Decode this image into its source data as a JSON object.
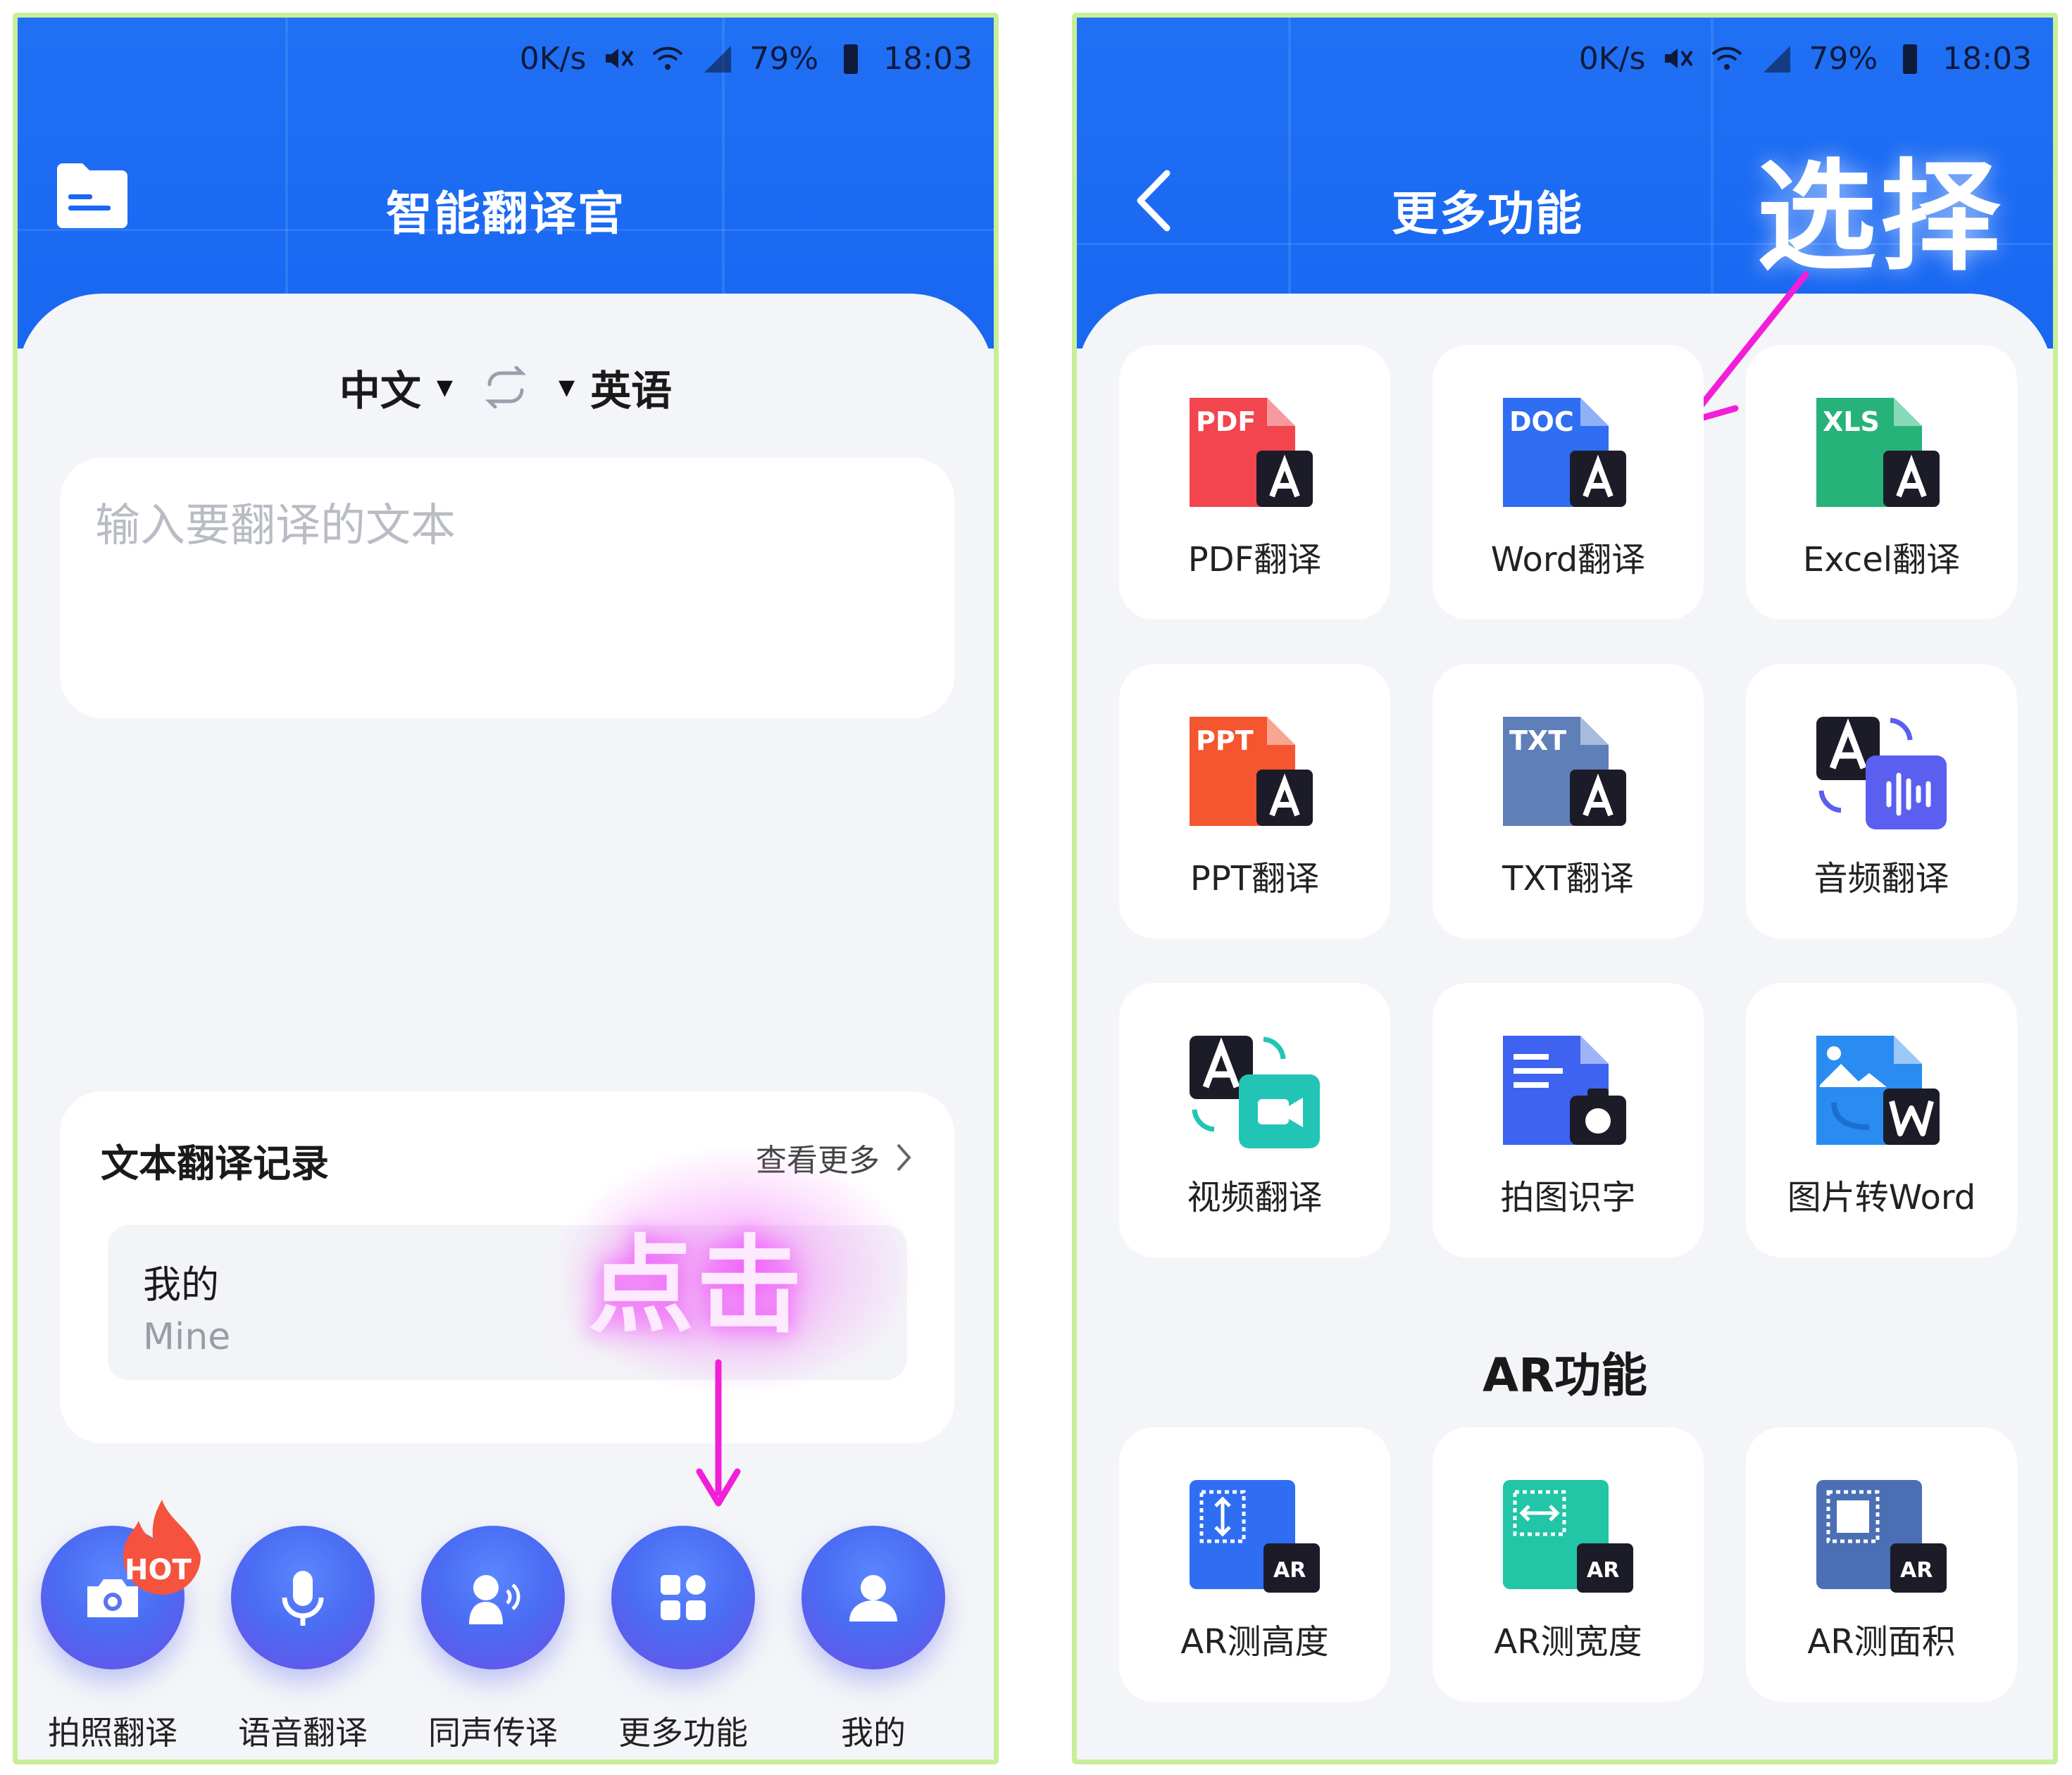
{
  "status_bar": {
    "speed": "0K/s",
    "battery": "79%",
    "time": "18:03"
  },
  "left_screen": {
    "title": "智能翻译官",
    "source_language": "中文",
    "target_language": "英语",
    "input_placeholder": "输入要翻译的文本",
    "history": {
      "title": "文本翻译记录",
      "view_more": "查看更多",
      "items": [
        {
          "source": "我的",
          "translation": "Mine"
        }
      ]
    },
    "annotation": "点击",
    "hot_badge": "HOT",
    "nav": [
      {
        "label": "拍照翻译",
        "icon": "camera-icon"
      },
      {
        "label": "语音翻译",
        "icon": "microphone-icon"
      },
      {
        "label": "同声传译",
        "icon": "speaker-person-icon"
      },
      {
        "label": "更多功能",
        "icon": "grid-icon"
      },
      {
        "label": "我的",
        "icon": "user-icon"
      }
    ]
  },
  "right_screen": {
    "title": "更多功能",
    "annotation": "选择",
    "features": [
      {
        "label": "PDF翻译",
        "badge": "PDF",
        "color": "#f2454e"
      },
      {
        "label": "Word翻译",
        "badge": "DOC",
        "color": "#2f6df2"
      },
      {
        "label": "Excel翻译",
        "badge": "XLS",
        "color": "#27b27a"
      },
      {
        "label": "PPT翻译",
        "badge": "PPT",
        "color": "#f5552f"
      },
      {
        "label": "TXT翻译",
        "badge": "TXT",
        "color": "#5f7fb8"
      },
      {
        "label": "音频翻译",
        "badge": "",
        "color": "#5a5ff0"
      },
      {
        "label": "视频翻译",
        "badge": "",
        "color": "#22c5b5"
      },
      {
        "label": "拍图识字",
        "badge": "",
        "color": "#3d63f0"
      },
      {
        "label": "图片转Word",
        "badge": "",
        "color": "#2a8bf0"
      }
    ],
    "ar_heading": "AR功能",
    "ar_features": [
      {
        "label": "AR测高度",
        "badge": "AR",
        "color": "#2f6df2"
      },
      {
        "label": "AR测宽度",
        "badge": "AR",
        "color": "#22c5a6"
      },
      {
        "label": "AR测面积",
        "badge": "AR",
        "color": "#4a6fb5"
      }
    ]
  },
  "colors": {
    "brand_blue": "#1967f2",
    "annotation_magenta": "#f21fd9",
    "frame_green": "#c9ee9a"
  }
}
